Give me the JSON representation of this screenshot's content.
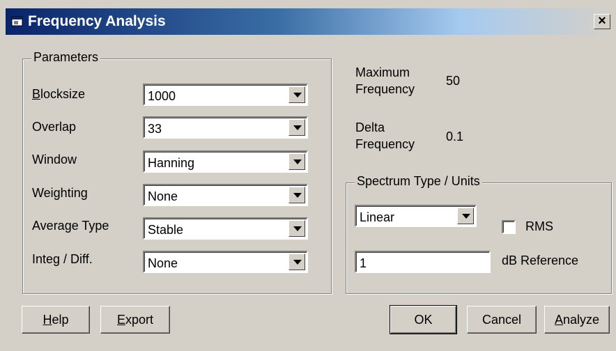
{
  "window": {
    "title": "Frequency Analysis",
    "close_glyph": "×",
    "icon": "app-window-icon"
  },
  "parameters": {
    "group_title": "Parameters",
    "rows": [
      {
        "label_pre": "",
        "label_ul": "B",
        "label_post": "locksize",
        "value": "1000"
      },
      {
        "label_pre": "Overlap",
        "label_ul": "",
        "label_post": "",
        "value": "33"
      },
      {
        "label_pre": "Window",
        "label_ul": "",
        "label_post": "",
        "value": "Hanning"
      },
      {
        "label_pre": "Weighting",
        "label_ul": "",
        "label_post": "",
        "value": "None"
      },
      {
        "label_pre": "Average Type",
        "label_ul": "",
        "label_post": "",
        "value": "Stable"
      },
      {
        "label_pre": "Integ / Diff.",
        "label_ul": "",
        "label_post": "",
        "value": "None"
      }
    ]
  },
  "info": {
    "max_freq_label_1": "Maximum",
    "max_freq_label_2": "Frequency",
    "max_freq_value": "50",
    "delta_freq_label_1": "Delta",
    "delta_freq_label_2": "Frequency",
    "delta_freq_value": "0.1"
  },
  "spectrum": {
    "group_title": "Spectrum Type / Units",
    "type_value": "Linear",
    "rms_label": "RMS",
    "rms_checked": false,
    "db_reference_value": "1",
    "db_reference_label": "dB Reference"
  },
  "buttons": {
    "help_ul": "H",
    "help_rest": "elp",
    "export_ul": "E",
    "export_rest": "xport",
    "ok": "OK",
    "cancel": "Cancel",
    "analyze_ul": "A",
    "analyze_rest": "nalyze"
  }
}
